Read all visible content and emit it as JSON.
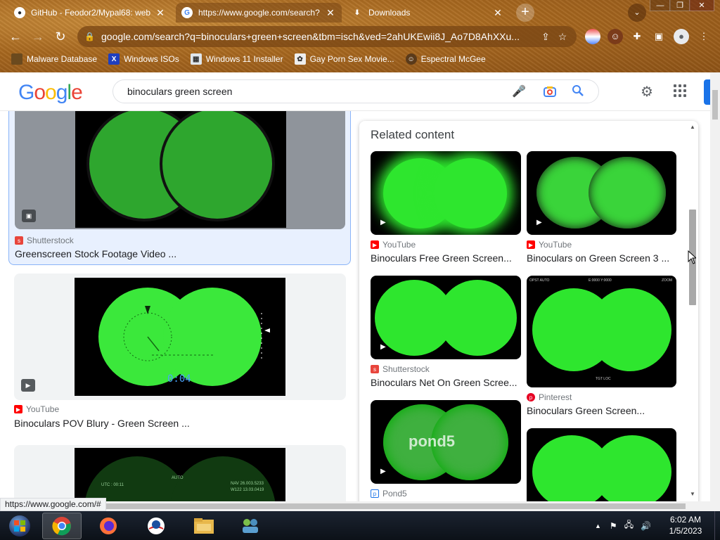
{
  "browser": {
    "tabs": [
      {
        "title": "GitHub - Feodor2/Mypal68: web b",
        "favicon": "github-icon",
        "active": false
      },
      {
        "title": "https://www.google.com/search?",
        "favicon": "google-icon",
        "active": true
      },
      {
        "title": "Downloads",
        "favicon": "download-icon",
        "active": false
      }
    ],
    "url": "google.com/search?q=binoculars+green+screen&tbm=isch&ved=2ahUKEwii8J_Ao7D8AhXXu...",
    "bookmarks": [
      {
        "label": "Malware Database",
        "icon": "malware-icon"
      },
      {
        "label": "Windows ISOs",
        "icon": "x-icon"
      },
      {
        "label": "Windows 11 Installer",
        "icon": "installer-icon"
      },
      {
        "label": "Gay Porn Sex Movie...",
        "icon": "bookmark-icon"
      },
      {
        "label": "Espectral McGee",
        "icon": "avatar-icon"
      }
    ]
  },
  "google": {
    "logo": "Google",
    "query": "binoculars green screen"
  },
  "results": [
    {
      "source": "Shutterstock",
      "source_color": "#e8453c",
      "title": "Greenscreen Stock Footage Video ...",
      "badge": "image-icon",
      "selected": true
    },
    {
      "source": "YouTube",
      "source_color": "#ff0000",
      "title": "Binoculars POV Blury - Green Screen ...",
      "badge": "play-icon",
      "timer": "0:04"
    },
    {
      "source": "",
      "title": "",
      "overlay_left": "UTC : 00:11",
      "overlay_mid": "AUTO",
      "overlay_right1": "NAV  26.003.5233",
      "overlay_right2": "W122  13.03.0419"
    }
  ],
  "related": {
    "heading": "Related content",
    "items": [
      {
        "source": "YouTube",
        "source_color": "#ff0000",
        "title": "Binoculars Free Green Screen..."
      },
      {
        "source": "YouTube",
        "source_color": "#ff0000",
        "title": "Binoculars on Green Screen 3 ..."
      },
      {
        "source": "Shutterstock",
        "source_color": "#e8453c",
        "title": "Binoculars Net On Green Scree..."
      },
      {
        "source": "Pinterest",
        "source_color": "#e60023",
        "title": "Binoculars Green Screen..."
      },
      {
        "source": "Pond5",
        "source_color": "#1a73e8",
        "title": "",
        "watermark": "pond5"
      },
      {
        "source": "",
        "title": ""
      }
    ],
    "hud": {
      "b_top_left": "OPST  AUTO",
      "b_top_mid": "E:0000  Y:0000",
      "b_top_right": "ZOOM",
      "b_bottom": "TGT  LOC"
    }
  },
  "status_url": "https://www.google.com/#",
  "taskbar": {
    "time": "6:02 AM",
    "date": "1/5/2023"
  },
  "colors": {
    "green": "#2ee62e",
    "google_blue": "#4285f4",
    "google_red": "#ea4335",
    "google_yellow": "#fbbc05",
    "google_green": "#34a853"
  }
}
